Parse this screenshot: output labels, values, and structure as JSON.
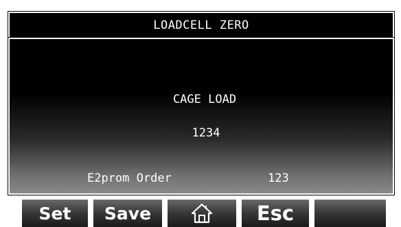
{
  "header": {
    "title": "LOADCELL ZERO"
  },
  "main": {
    "cage_load_label": "CAGE LOAD",
    "cage_load_value": "1234",
    "e2prom_label": "E2prom Order",
    "e2prom_value": "123"
  },
  "toolbar": {
    "set_label": "Set",
    "save_label": "Save",
    "home_icon": "home-icon",
    "esc_label": "Esc",
    "blank_label": ""
  },
  "colors": {
    "background": "#000000",
    "text": "#ffffff",
    "border": "#ffffff"
  }
}
